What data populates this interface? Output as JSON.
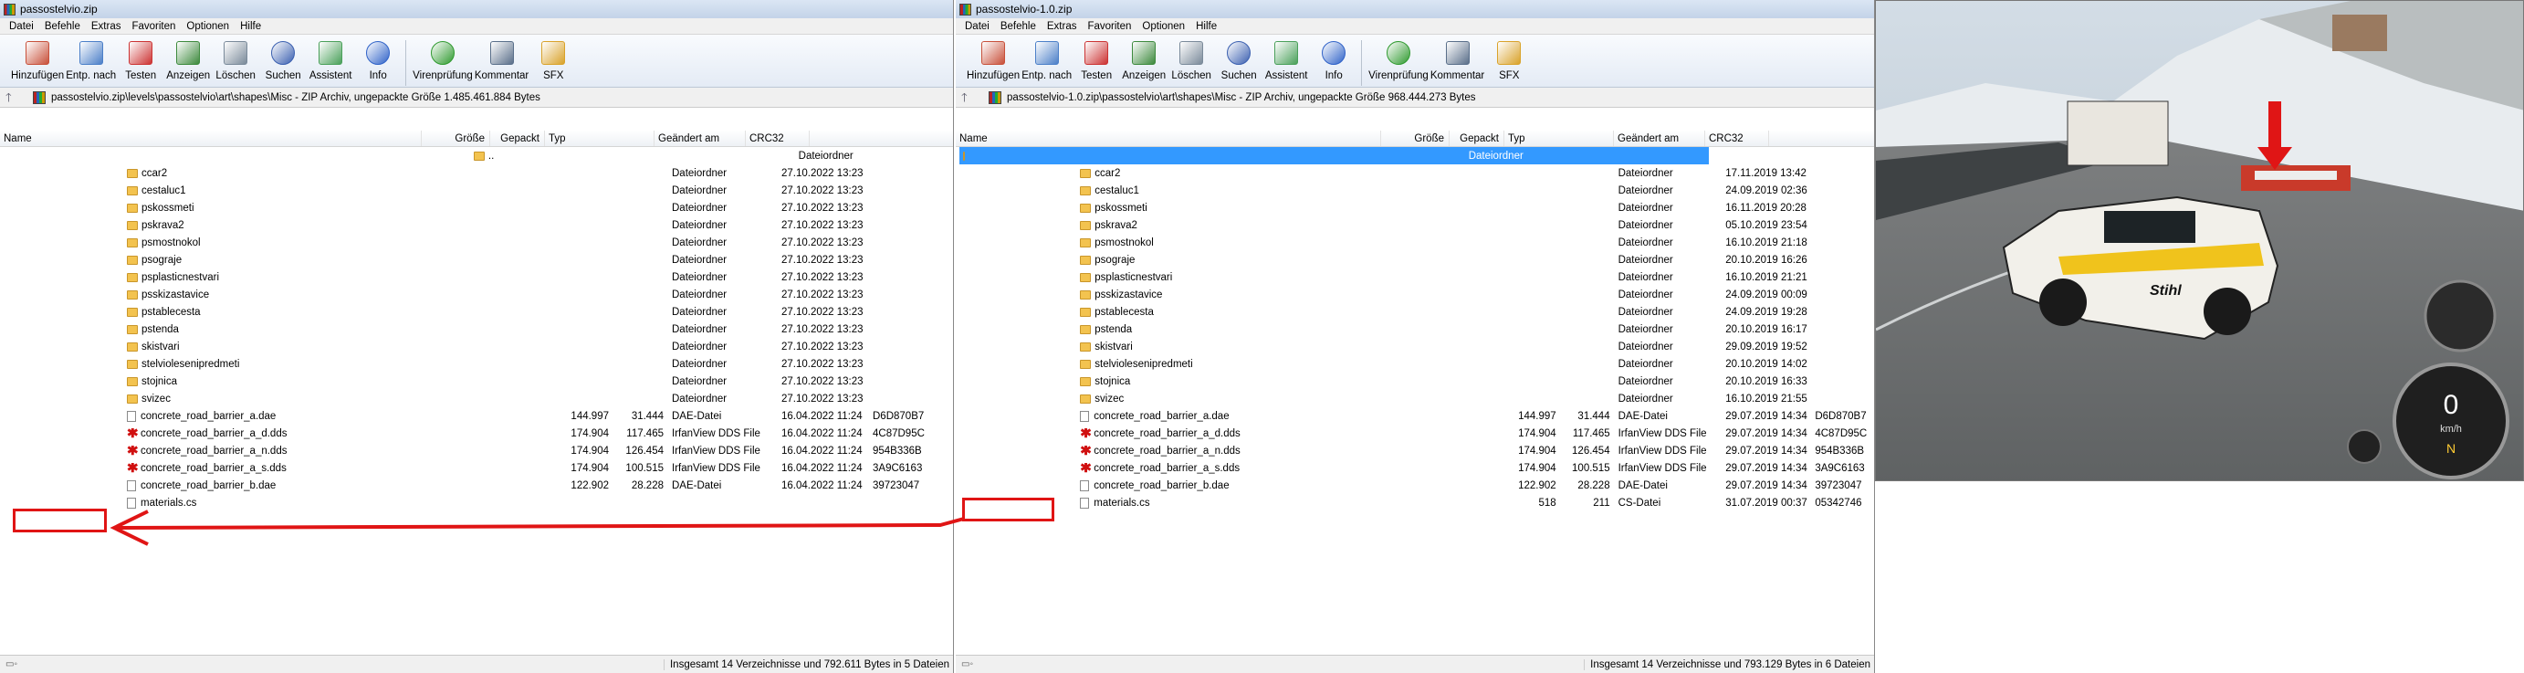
{
  "left_window": {
    "title": "passostelvio.zip",
    "menu": [
      "Datei",
      "Befehle",
      "Extras",
      "Favoriten",
      "Optionen",
      "Hilfe"
    ],
    "toolbar": [
      {
        "label": "Hinzufügen",
        "icon": "add-archive-icon"
      },
      {
        "label": "Entp. nach",
        "icon": "extract-to-icon"
      },
      {
        "label": "Testen",
        "icon": "test-icon"
      },
      {
        "label": "Anzeigen",
        "icon": "view-icon"
      },
      {
        "label": "Löschen",
        "icon": "delete-icon"
      },
      {
        "label": "Suchen",
        "icon": "find-icon"
      },
      {
        "label": "Assistent",
        "icon": "wizard-icon"
      },
      {
        "label": "Info",
        "icon": "info-icon"
      },
      {
        "label": "Virenprüfung",
        "icon": "virus-scan-icon"
      },
      {
        "label": "Kommentar",
        "icon": "comment-icon"
      },
      {
        "label": "SFX",
        "icon": "sfx-icon"
      }
    ],
    "address": "passostelvio.zip\\levels\\passostelvio\\art\\shapes\\Misc - ZIP Archiv, ungepackte Größe 1.485.461.884 Bytes",
    "columns": [
      "Name",
      "Größe",
      "Gepackt",
      "Typ",
      "Geändert am",
      "CRC32"
    ],
    "rows": [
      {
        "name": "..",
        "size": "",
        "packed": "",
        "type": "Dateiordner",
        "date": "",
        "crc": "",
        "kind": "folder"
      },
      {
        "name": "ccar2",
        "size": "",
        "packed": "",
        "type": "Dateiordner",
        "date": "27.10.2022 13:23",
        "crc": "",
        "kind": "folder"
      },
      {
        "name": "cestaluc1",
        "size": "",
        "packed": "",
        "type": "Dateiordner",
        "date": "27.10.2022 13:23",
        "crc": "",
        "kind": "folder"
      },
      {
        "name": "pskossmeti",
        "size": "",
        "packed": "",
        "type": "Dateiordner",
        "date": "27.10.2022 13:23",
        "crc": "",
        "kind": "folder"
      },
      {
        "name": "pskrava2",
        "size": "",
        "packed": "",
        "type": "Dateiordner",
        "date": "27.10.2022 13:23",
        "crc": "",
        "kind": "folder"
      },
      {
        "name": "psmostnokol",
        "size": "",
        "packed": "",
        "type": "Dateiordner",
        "date": "27.10.2022 13:23",
        "crc": "",
        "kind": "folder"
      },
      {
        "name": "psograje",
        "size": "",
        "packed": "",
        "type": "Dateiordner",
        "date": "27.10.2022 13:23",
        "crc": "",
        "kind": "folder"
      },
      {
        "name": "psplasticnestvari",
        "size": "",
        "packed": "",
        "type": "Dateiordner",
        "date": "27.10.2022 13:23",
        "crc": "",
        "kind": "folder"
      },
      {
        "name": "psskizastavice",
        "size": "",
        "packed": "",
        "type": "Dateiordner",
        "date": "27.10.2022 13:23",
        "crc": "",
        "kind": "folder"
      },
      {
        "name": "pstablecesta",
        "size": "",
        "packed": "",
        "type": "Dateiordner",
        "date": "27.10.2022 13:23",
        "crc": "",
        "kind": "folder"
      },
      {
        "name": "pstenda",
        "size": "",
        "packed": "",
        "type": "Dateiordner",
        "date": "27.10.2022 13:23",
        "crc": "",
        "kind": "folder"
      },
      {
        "name": "skistvari",
        "size": "",
        "packed": "",
        "type": "Dateiordner",
        "date": "27.10.2022 13:23",
        "crc": "",
        "kind": "folder"
      },
      {
        "name": "stelviolesenipredmeti",
        "size": "",
        "packed": "",
        "type": "Dateiordner",
        "date": "27.10.2022 13:23",
        "crc": "",
        "kind": "folder"
      },
      {
        "name": "stojnica",
        "size": "",
        "packed": "",
        "type": "Dateiordner",
        "date": "27.10.2022 13:23",
        "crc": "",
        "kind": "folder"
      },
      {
        "name": "svizec",
        "size": "",
        "packed": "",
        "type": "Dateiordner",
        "date": "27.10.2022 13:23",
        "crc": "",
        "kind": "folder"
      },
      {
        "name": "concrete_road_barrier_a.dae",
        "size": "144.997",
        "packed": "31.444",
        "type": "DAE-Datei",
        "date": "16.04.2022 11:24",
        "crc": "D6D870B7",
        "kind": "file"
      },
      {
        "name": "concrete_road_barrier_a_d.dds",
        "size": "174.904",
        "packed": "117.465",
        "type": "IrfanView DDS File",
        "date": "16.04.2022 11:24",
        "crc": "4C87D95C",
        "kind": "dds"
      },
      {
        "name": "concrete_road_barrier_a_n.dds",
        "size": "174.904",
        "packed": "126.454",
        "type": "IrfanView DDS File",
        "date": "16.04.2022 11:24",
        "crc": "954B336B",
        "kind": "dds"
      },
      {
        "name": "concrete_road_barrier_a_s.dds",
        "size": "174.904",
        "packed": "100.515",
        "type": "IrfanView DDS File",
        "date": "16.04.2022 11:24",
        "crc": "3A9C6163",
        "kind": "dds"
      },
      {
        "name": "concrete_road_barrier_b.dae",
        "size": "122.902",
        "packed": "28.228",
        "type": "DAE-Datei",
        "date": "16.04.2022 11:24",
        "crc": "39723047",
        "kind": "file"
      },
      {
        "name": "materials.cs",
        "size": "",
        "packed": "",
        "type": "",
        "date": "",
        "crc": "",
        "kind": "file"
      }
    ],
    "status": "Insgesamt 14 Verzeichnisse und 792.611 Bytes in 5 Dateien"
  },
  "right_window": {
    "title": "passostelvio-1.0.zip",
    "menu": [
      "Datei",
      "Befehle",
      "Extras",
      "Favoriten",
      "Optionen",
      "Hilfe"
    ],
    "toolbar": [
      {
        "label": "Hinzufügen",
        "icon": "add-archive-icon"
      },
      {
        "label": "Entp. nach",
        "icon": "extract-to-icon"
      },
      {
        "label": "Testen",
        "icon": "test-icon"
      },
      {
        "label": "Anzeigen",
        "icon": "view-icon"
      },
      {
        "label": "Löschen",
        "icon": "delete-icon"
      },
      {
        "label": "Suchen",
        "icon": "find-icon"
      },
      {
        "label": "Assistent",
        "icon": "wizard-icon"
      },
      {
        "label": "Info",
        "icon": "info-icon"
      },
      {
        "label": "Virenprüfung",
        "icon": "virus-scan-icon"
      },
      {
        "label": "Kommentar",
        "icon": "comment-icon"
      },
      {
        "label": "SFX",
        "icon": "sfx-icon"
      }
    ],
    "address": "passostelvio-1.0.zip\\passostelvio\\art\\shapes\\Misc - ZIP Archiv, ungepackte Größe 968.444.273 Bytes",
    "columns": [
      "Name",
      "Größe",
      "Gepackt",
      "Typ",
      "Geändert am",
      "CRC32"
    ],
    "rows": [
      {
        "name": "",
        "size": "",
        "packed": "",
        "type": "Dateiordner",
        "date": "",
        "crc": "",
        "kind": "folder",
        "selected": true
      },
      {
        "name": "ccar2",
        "size": "",
        "packed": "",
        "type": "Dateiordner",
        "date": "17.11.2019 13:42",
        "crc": "",
        "kind": "folder"
      },
      {
        "name": "cestaluc1",
        "size": "",
        "packed": "",
        "type": "Dateiordner",
        "date": "24.09.2019 02:36",
        "crc": "",
        "kind": "folder"
      },
      {
        "name": "pskossmeti",
        "size": "",
        "packed": "",
        "type": "Dateiordner",
        "date": "16.11.2019 20:28",
        "crc": "",
        "kind": "folder"
      },
      {
        "name": "pskrava2",
        "size": "",
        "packed": "",
        "type": "Dateiordner",
        "date": "05.10.2019 23:54",
        "crc": "",
        "kind": "folder"
      },
      {
        "name": "psmostnokol",
        "size": "",
        "packed": "",
        "type": "Dateiordner",
        "date": "16.10.2019 21:18",
        "crc": "",
        "kind": "folder"
      },
      {
        "name": "psograje",
        "size": "",
        "packed": "",
        "type": "Dateiordner",
        "date": "20.10.2019 16:26",
        "crc": "",
        "kind": "folder"
      },
      {
        "name": "psplasticnestvari",
        "size": "",
        "packed": "",
        "type": "Dateiordner",
        "date": "16.10.2019 21:21",
        "crc": "",
        "kind": "folder"
      },
      {
        "name": "psskizastavice",
        "size": "",
        "packed": "",
        "type": "Dateiordner",
        "date": "24.09.2019 00:09",
        "crc": "",
        "kind": "folder"
      },
      {
        "name": "pstablecesta",
        "size": "",
        "packed": "",
        "type": "Dateiordner",
        "date": "24.09.2019 19:28",
        "crc": "",
        "kind": "folder"
      },
      {
        "name": "pstenda",
        "size": "",
        "packed": "",
        "type": "Dateiordner",
        "date": "20.10.2019 16:17",
        "crc": "",
        "kind": "folder"
      },
      {
        "name": "skistvari",
        "size": "",
        "packed": "",
        "type": "Dateiordner",
        "date": "29.09.2019 19:52",
        "crc": "",
        "kind": "folder"
      },
      {
        "name": "stelviolesenipredmeti",
        "size": "",
        "packed": "",
        "type": "Dateiordner",
        "date": "20.10.2019 14:02",
        "crc": "",
        "kind": "folder"
      },
      {
        "name": "stojnica",
        "size": "",
        "packed": "",
        "type": "Dateiordner",
        "date": "20.10.2019 16:33",
        "crc": "",
        "kind": "folder"
      },
      {
        "name": "svizec",
        "size": "",
        "packed": "",
        "type": "Dateiordner",
        "date": "16.10.2019 21:55",
        "crc": "",
        "kind": "folder"
      },
      {
        "name": "concrete_road_barrier_a.dae",
        "size": "144.997",
        "packed": "31.444",
        "type": "DAE-Datei",
        "date": "29.07.2019 14:34",
        "crc": "D6D870B7",
        "kind": "file"
      },
      {
        "name": "concrete_road_barrier_a_d.dds",
        "size": "174.904",
        "packed": "117.465",
        "type": "IrfanView DDS File",
        "date": "29.07.2019 14:34",
        "crc": "4C87D95C",
        "kind": "dds"
      },
      {
        "name": "concrete_road_barrier_a_n.dds",
        "size": "174.904",
        "packed": "126.454",
        "type": "IrfanView DDS File",
        "date": "29.07.2019 14:34",
        "crc": "954B336B",
        "kind": "dds"
      },
      {
        "name": "concrete_road_barrier_a_s.dds",
        "size": "174.904",
        "packed": "100.515",
        "type": "IrfanView DDS File",
        "date": "29.07.2019 14:34",
        "crc": "3A9C6163",
        "kind": "dds"
      },
      {
        "name": "concrete_road_barrier_b.dae",
        "size": "122.902",
        "packed": "28.228",
        "type": "DAE-Datei",
        "date": "29.07.2019 14:34",
        "crc": "39723047",
        "kind": "file"
      },
      {
        "name": "materials.cs",
        "size": "518",
        "packed": "211",
        "type": "CS-Datei",
        "date": "31.07.2019 00:37",
        "crc": "05342746",
        "kind": "file"
      }
    ],
    "status": "Insgesamt 14 Verzeichnisse und 793.129 Bytes in 6 Dateien"
  },
  "game": {
    "speed": "0",
    "speed_unit": "km/h",
    "gear": "N",
    "car_decal": "Stihl"
  },
  "colors": {
    "highlight": "#e01515",
    "selection": "#3399ff"
  }
}
